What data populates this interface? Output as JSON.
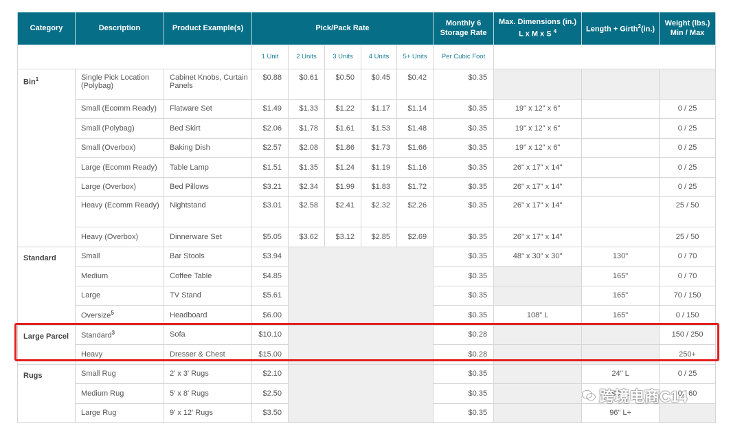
{
  "header": {
    "category": "Category",
    "description": "Description",
    "product_examples": "Product Example(s)",
    "pick_pack_rate": "Pick/Pack Rate",
    "monthly_line1": "Monthly",
    "monthly_sup": "6",
    "monthly_line2": "Storage Rate",
    "maxdim_line1": "Max. Dimensions (in.)",
    "maxdim_line2": "L x M x S",
    "maxdim_sup": "4",
    "length_girth": "Length + Girth",
    "length_girth_sup": "2",
    "length_girth_unit": "(in.)",
    "weight_line1": "Weight (lbs.)",
    "weight_line2": "Min / Max"
  },
  "subheader": {
    "u1": "1 Unit",
    "u2": "2 Units",
    "u3": "3 Units",
    "u4": "4 Units",
    "u5": "5+ Units",
    "per_cubic_foot": "Per Cubic Foot"
  },
  "groups": [
    {
      "category": "Bin",
      "category_sup": "1",
      "rows": [
        {
          "desc": "Single Pick Location (Polybag)",
          "example": "Cabinet Knobs, Curtain Panels",
          "u1": "$0.88",
          "u2": "$0.61",
          "u3": "$0.50",
          "u4": "$0.45",
          "u5": "$0.42",
          "storage": "$0.35",
          "dims": "",
          "girth": "",
          "weight": ""
        },
        {
          "desc": "Small (Ecomm Ready)",
          "example": "Flatware Set",
          "u1": "$1.49",
          "u2": "$1.33",
          "u3": "$1.22",
          "u4": "$1.17",
          "u5": "$1.14",
          "storage": "$0.35",
          "dims": "19\" x 12\" x 6\"",
          "girth": "",
          "weight": "0 / 25"
        },
        {
          "desc": "Small (Polybag)",
          "example": "Bed Skirt",
          "u1": "$2.06",
          "u2": "$1.78",
          "u3": "$1.61",
          "u4": "$1.53",
          "u5": "$1.48",
          "storage": "$0.35",
          "dims": "19\" x 12\" x 6\"",
          "girth": "",
          "weight": "0 / 25"
        },
        {
          "desc": "Small (Overbox)",
          "example": "Baking Dish",
          "u1": "$2.57",
          "u2": "$2.08",
          "u3": "$1.86",
          "u4": "$1.73",
          "u5": "$1.66",
          "storage": "$0.35",
          "dims": "19\" x 12\" x 6\"",
          "girth": "",
          "weight": "0 / 25"
        },
        {
          "desc": "Large (Ecomm Ready)",
          "example": "Table Lamp",
          "u1": "$1.51",
          "u2": "$1.35",
          "u3": "$1.24",
          "u4": "$1.19",
          "u5": "$1.16",
          "storage": "$0.35",
          "dims": "26\" x 17\" x 14\"",
          "girth": "",
          "weight": "0 / 25"
        },
        {
          "desc": "Large (Overbox)",
          "example": "Bed Pillows",
          "u1": "$3.21",
          "u2": "$2.34",
          "u3": "$1.99",
          "u4": "$1.83",
          "u5": "$1.72",
          "storage": "$0.35",
          "dims": "26\" x 17\" x 14\"",
          "girth": "",
          "weight": "0 / 25"
        },
        {
          "desc": "Heavy (Ecomm Ready)",
          "example": "Nightstand",
          "u1": "$3.01",
          "u2": "$2.58",
          "u3": "$2.41",
          "u4": "$2.32",
          "u5": "$2.26",
          "storage": "$0.35",
          "dims": "26\" x 17\" x 14\"",
          "girth": "",
          "weight": "25 / 50"
        },
        {
          "desc": "Heavy (Overbox)",
          "example": "Dinnerware Set",
          "u1": "$5.05",
          "u2": "$3.62",
          "u3": "$3.12",
          "u4": "$2.85",
          "u5": "$2.69",
          "storage": "$0.35",
          "dims": "26\" x 17\" x 14\"",
          "girth": "",
          "weight": "25 / 50"
        }
      ]
    },
    {
      "category": "Standard",
      "rows": [
        {
          "desc": "Small",
          "example": "Bar Stools",
          "u1": "$3.94",
          "storage": "$0.35",
          "dims": "48\" x 30\" x  30\"",
          "girth": "130\"",
          "weight": "0 / 70"
        },
        {
          "desc": "Medium",
          "example": "Coffee Table",
          "u1": "$4.85",
          "storage": "$0.35",
          "dims": "",
          "girth": "165\"",
          "weight": "0 / 70"
        },
        {
          "desc": "Large",
          "example": "TV Stand",
          "u1": "$5.61",
          "storage": "$0.35",
          "dims": "",
          "girth": "165\"",
          "weight": "70 / 150"
        },
        {
          "desc": "Oversize",
          "desc_sup": "5",
          "example": "Headboard",
          "u1": "$6.00",
          "storage": "$0.35",
          "dims": "108\" L",
          "girth": "165\"",
          "weight": "0 / 150"
        }
      ]
    },
    {
      "category": "Large Parcel",
      "rows": [
        {
          "desc": "Standard",
          "desc_sup": "3",
          "example": "Sofa",
          "u1": "$10.10",
          "storage": "$0.28",
          "dims": "",
          "girth": "",
          "weight": "150 / 250"
        },
        {
          "desc": "Heavy",
          "example": "Dresser & Chest",
          "u1": "$15.00",
          "storage": "$0.28",
          "dims": "",
          "girth": "",
          "weight": "250+"
        }
      ]
    },
    {
      "category": "Rugs",
      "rows": [
        {
          "desc": "Small Rug",
          "example": "2' x 3' Rugs",
          "u1": "$2.10",
          "storage": "$0.35",
          "dims": "",
          "girth": "24\" L",
          "weight": "0 / 25"
        },
        {
          "desc": "Medium Rug",
          "example": "5' x 8' Rugs",
          "u1": "$2.50",
          "storage": "$0.35",
          "dims": "",
          "girth": "96\" L",
          "weight": "0 / 60"
        },
        {
          "desc": "Large Rug",
          "example": "9' x 12' Rugs",
          "u1": "$3.50",
          "storage": "$0.35",
          "dims": "",
          "girth": "96\" L+",
          "weight": ""
        }
      ]
    }
  ],
  "watermark": "跨境电商C14",
  "colors": {
    "header_bg": "#066e86",
    "subheader_text": "#1a7f96",
    "highlight": "#e21e1e",
    "gray_cell": "#efefef"
  }
}
